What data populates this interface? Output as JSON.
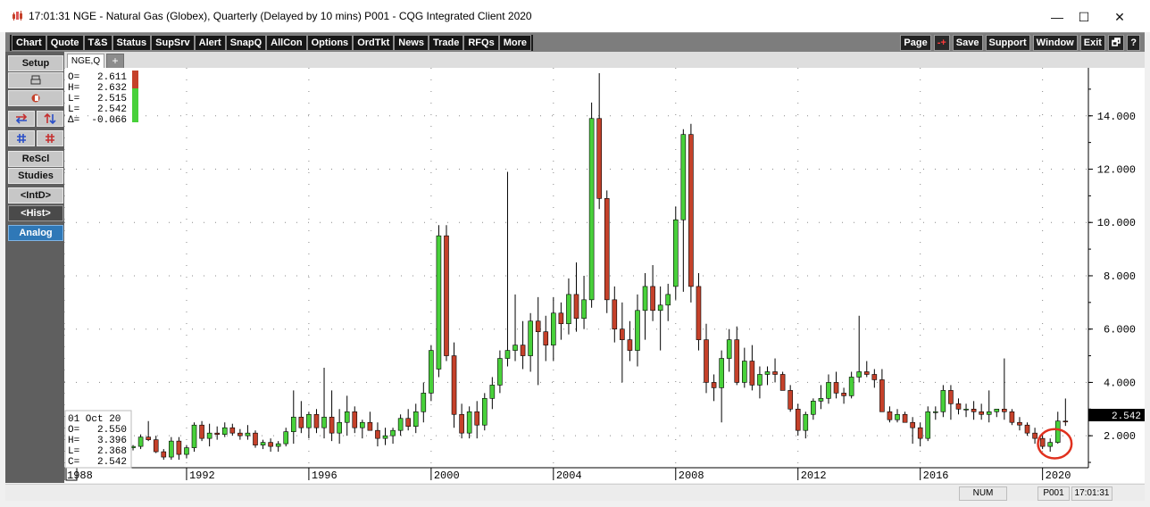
{
  "window": {
    "title": "17:01:31   NGE - Natural Gas (Globex), Quarterly (Delayed by 10 mins)   P001 - CQG Integrated Client 2020",
    "minimize": "—",
    "maximize": "☐",
    "close": "✕"
  },
  "toolbar": {
    "left": [
      "Chart",
      "Quote",
      "T&S",
      "Status",
      "SupSrv",
      "Alert",
      "SnapQ",
      "AllCon",
      "Options",
      "OrdTkt",
      "News",
      "Trade",
      "RFQs",
      "More"
    ],
    "right": [
      "Page",
      "-+",
      "Save",
      "Support",
      "Window",
      "Exit",
      "🗗",
      "?"
    ]
  },
  "sidebar": {
    "setup": "Setup",
    "rescl": "ReScl",
    "studies": "Studies",
    "intd": "<IntD>",
    "hist": "<Hist>",
    "analog": "Analog"
  },
  "tabs": {
    "active": "NGE,Q",
    "add": "+"
  },
  "status": {
    "num": "NUM",
    "page": "P001",
    "time": "17:01:31"
  },
  "chart_data": {
    "type": "candlestick",
    "symbol": "NGE,Q",
    "ylim": [
      0.8,
      15.8
    ],
    "yticks": [
      2,
      4,
      6,
      8,
      10,
      12,
      14
    ],
    "ytick_labels": [
      "2.000",
      "4.000",
      "6.000",
      "8.000",
      "10.000",
      "12.000",
      "14.000"
    ],
    "xlim": [
      1988,
      2021.5
    ],
    "xtick_labels": [
      "1988",
      "1992",
      "1996",
      "2000",
      "2004",
      "2008",
      "2012",
      "2016",
      "2020"
    ],
    "last_price": "2.542",
    "top_info": {
      "O": "2.611",
      "H": "2.632",
      "L": "2.515",
      "C": "2.542",
      "D": "-0.066"
    },
    "bottom_info": {
      "date": "01 Oct 20",
      "O": "2.550",
      "H": "3.396",
      "L": "2.368",
      "C": "2.542"
    },
    "candles": [
      {
        "t": 1990.25,
        "o": 1.55,
        "h": 1.65,
        "l": 1.45,
        "c": 1.6
      },
      {
        "t": 1990.5,
        "o": 1.6,
        "h": 2.05,
        "l": 1.5,
        "c": 1.95
      },
      {
        "t": 1990.75,
        "o": 1.95,
        "h": 2.55,
        "l": 1.8,
        "c": 1.85
      },
      {
        "t": 1991.0,
        "o": 1.85,
        "h": 2.0,
        "l": 1.35,
        "c": 1.4
      },
      {
        "t": 1991.25,
        "o": 1.4,
        "h": 1.5,
        "l": 1.1,
        "c": 1.2
      },
      {
        "t": 1991.5,
        "o": 1.2,
        "h": 1.95,
        "l": 1.1,
        "c": 1.8
      },
      {
        "t": 1991.75,
        "o": 1.8,
        "h": 1.95,
        "l": 1.1,
        "c": 1.3
      },
      {
        "t": 1992.0,
        "o": 1.3,
        "h": 1.65,
        "l": 1.15,
        "c": 1.55
      },
      {
        "t": 1992.25,
        "o": 1.55,
        "h": 2.5,
        "l": 1.4,
        "c": 2.4
      },
      {
        "t": 1992.5,
        "o": 2.4,
        "h": 2.55,
        "l": 1.8,
        "c": 1.9
      },
      {
        "t": 1992.75,
        "o": 1.9,
        "h": 2.45,
        "l": 1.6,
        "c": 2.1
      },
      {
        "t": 1993.0,
        "o": 2.1,
        "h": 2.35,
        "l": 1.85,
        "c": 2.05
      },
      {
        "t": 1993.25,
        "o": 2.05,
        "h": 2.5,
        "l": 1.95,
        "c": 2.3
      },
      {
        "t": 1993.5,
        "o": 2.3,
        "h": 2.45,
        "l": 2.0,
        "c": 2.1
      },
      {
        "t": 1993.75,
        "o": 2.1,
        "h": 2.25,
        "l": 1.85,
        "c": 2.0
      },
      {
        "t": 1994.0,
        "o": 2.0,
        "h": 2.4,
        "l": 1.85,
        "c": 2.1
      },
      {
        "t": 1994.25,
        "o": 2.1,
        "h": 2.2,
        "l": 1.55,
        "c": 1.65
      },
      {
        "t": 1994.5,
        "o": 1.65,
        "h": 1.85,
        "l": 1.5,
        "c": 1.75
      },
      {
        "t": 1994.75,
        "o": 1.75,
        "h": 1.9,
        "l": 1.4,
        "c": 1.6
      },
      {
        "t": 1995.0,
        "o": 1.6,
        "h": 1.8,
        "l": 1.4,
        "c": 1.7
      },
      {
        "t": 1995.25,
        "o": 1.7,
        "h": 2.3,
        "l": 1.6,
        "c": 2.15
      },
      {
        "t": 1995.5,
        "o": 2.15,
        "h": 3.7,
        "l": 1.7,
        "c": 2.7
      },
      {
        "t": 1995.75,
        "o": 2.7,
        "h": 3.3,
        "l": 2.1,
        "c": 2.3
      },
      {
        "t": 1996.0,
        "o": 2.3,
        "h": 2.9,
        "l": 1.9,
        "c": 2.8
      },
      {
        "t": 1996.25,
        "o": 2.8,
        "h": 3.0,
        "l": 2.1,
        "c": 2.3
      },
      {
        "t": 1996.5,
        "o": 2.3,
        "h": 4.55,
        "l": 1.9,
        "c": 2.7
      },
      {
        "t": 1996.75,
        "o": 2.7,
        "h": 3.7,
        "l": 1.8,
        "c": 2.1
      },
      {
        "t": 1997.0,
        "o": 2.1,
        "h": 3.0,
        "l": 1.7,
        "c": 2.5
      },
      {
        "t": 1997.25,
        "o": 2.5,
        "h": 3.5,
        "l": 2.0,
        "c": 2.9
      },
      {
        "t": 1997.5,
        "o": 2.9,
        "h": 3.1,
        "l": 2.1,
        "c": 2.3
      },
      {
        "t": 1997.75,
        "o": 2.3,
        "h": 2.6,
        "l": 1.9,
        "c": 2.5
      },
      {
        "t": 1998.0,
        "o": 2.5,
        "h": 2.9,
        "l": 2.2,
        "c": 2.2
      },
      {
        "t": 1998.25,
        "o": 2.2,
        "h": 2.5,
        "l": 1.6,
        "c": 1.9
      },
      {
        "t": 1998.5,
        "o": 1.9,
        "h": 2.3,
        "l": 1.65,
        "c": 2.0
      },
      {
        "t": 1998.75,
        "o": 2.0,
        "h": 2.3,
        "l": 1.7,
        "c": 2.2
      },
      {
        "t": 1999.0,
        "o": 2.2,
        "h": 2.8,
        "l": 2.0,
        "c": 2.65
      },
      {
        "t": 1999.25,
        "o": 2.65,
        "h": 3.0,
        "l": 2.2,
        "c": 2.35
      },
      {
        "t": 1999.5,
        "o": 2.35,
        "h": 3.2,
        "l": 2.1,
        "c": 2.9
      },
      {
        "t": 1999.75,
        "o": 2.9,
        "h": 4.0,
        "l": 2.5,
        "c": 3.6
      },
      {
        "t": 2000.0,
        "o": 3.6,
        "h": 5.4,
        "l": 3.3,
        "c": 5.2
      },
      {
        "t": 2000.25,
        "o": 4.5,
        "h": 9.9,
        "l": 4.2,
        "c": 9.5
      },
      {
        "t": 2000.5,
        "o": 9.5,
        "h": 9.9,
        "l": 4.8,
        "c": 5.0
      },
      {
        "t": 2000.75,
        "o": 5.0,
        "h": 5.5,
        "l": 2.3,
        "c": 2.8
      },
      {
        "t": 2001.0,
        "o": 2.8,
        "h": 3.2,
        "l": 1.9,
        "c": 2.1
      },
      {
        "t": 2001.25,
        "o": 2.1,
        "h": 3.1,
        "l": 1.9,
        "c": 2.9
      },
      {
        "t": 2001.5,
        "o": 2.9,
        "h": 3.3,
        "l": 1.9,
        "c": 2.4
      },
      {
        "t": 2001.75,
        "o": 2.4,
        "h": 3.6,
        "l": 2.2,
        "c": 3.4
      },
      {
        "t": 2002.0,
        "o": 3.4,
        "h": 4.2,
        "l": 3.0,
        "c": 3.9
      },
      {
        "t": 2002.25,
        "o": 3.9,
        "h": 5.2,
        "l": 3.6,
        "c": 4.9
      },
      {
        "t": 2002.5,
        "o": 4.9,
        "h": 11.9,
        "l": 4.6,
        "c": 5.2
      },
      {
        "t": 2002.75,
        "o": 5.2,
        "h": 7.3,
        "l": 4.8,
        "c": 5.4
      },
      {
        "t": 2003.0,
        "o": 5.4,
        "h": 6.3,
        "l": 4.5,
        "c": 5.0
      },
      {
        "t": 2003.25,
        "o": 5.0,
        "h": 6.6,
        "l": 4.4,
        "c": 6.3
      },
      {
        "t": 2003.5,
        "o": 6.3,
        "h": 7.2,
        "l": 3.9,
        "c": 5.9
      },
      {
        "t": 2003.75,
        "o": 5.9,
        "h": 6.5,
        "l": 4.8,
        "c": 5.4
      },
      {
        "t": 2004.0,
        "o": 5.4,
        "h": 7.2,
        "l": 4.8,
        "c": 6.6
      },
      {
        "t": 2004.25,
        "o": 6.6,
        "h": 7.0,
        "l": 5.6,
        "c": 6.2
      },
      {
        "t": 2004.5,
        "o": 6.2,
        "h": 7.9,
        "l": 5.8,
        "c": 7.3
      },
      {
        "t": 2004.75,
        "o": 7.3,
        "h": 8.5,
        "l": 5.9,
        "c": 6.4
      },
      {
        "t": 2005.0,
        "o": 6.4,
        "h": 8.0,
        "l": 6.0,
        "c": 7.1
      },
      {
        "t": 2005.25,
        "o": 7.1,
        "h": 14.5,
        "l": 6.8,
        "c": 13.9
      },
      {
        "t": 2005.5,
        "o": 13.9,
        "h": 15.6,
        "l": 10.5,
        "c": 10.9
      },
      {
        "t": 2005.75,
        "o": 10.9,
        "h": 11.2,
        "l": 6.6,
        "c": 7.1
      },
      {
        "t": 2006.0,
        "o": 7.1,
        "h": 7.6,
        "l": 5.5,
        "c": 6.0
      },
      {
        "t": 2006.25,
        "o": 6.0,
        "h": 7.0,
        "l": 4.0,
        "c": 5.6
      },
      {
        "t": 2006.5,
        "o": 5.6,
        "h": 6.3,
        "l": 4.8,
        "c": 5.2
      },
      {
        "t": 2006.75,
        "o": 5.2,
        "h": 7.3,
        "l": 4.6,
        "c": 6.7
      },
      {
        "t": 2007.0,
        "o": 6.7,
        "h": 8.1,
        "l": 5.6,
        "c": 7.6
      },
      {
        "t": 2007.25,
        "o": 7.6,
        "h": 8.4,
        "l": 6.3,
        "c": 6.7
      },
      {
        "t": 2007.5,
        "o": 6.7,
        "h": 7.6,
        "l": 5.2,
        "c": 6.9
      },
      {
        "t": 2007.75,
        "o": 6.9,
        "h": 7.7,
        "l": 6.3,
        "c": 7.3
      },
      {
        "t": 2008.0,
        "o": 7.6,
        "h": 10.6,
        "l": 7.1,
        "c": 10.1
      },
      {
        "t": 2008.25,
        "o": 10.1,
        "h": 13.5,
        "l": 7.4,
        "c": 13.3
      },
      {
        "t": 2008.5,
        "o": 13.3,
        "h": 13.7,
        "l": 7.0,
        "c": 7.6
      },
      {
        "t": 2008.75,
        "o": 7.6,
        "h": 8.1,
        "l": 5.2,
        "c": 5.6
      },
      {
        "t": 2009.0,
        "o": 5.6,
        "h": 6.2,
        "l": 3.6,
        "c": 4.0
      },
      {
        "t": 2009.25,
        "o": 4.0,
        "h": 4.3,
        "l": 3.3,
        "c": 3.8
      },
      {
        "t": 2009.5,
        "o": 3.8,
        "h": 5.2,
        "l": 2.5,
        "c": 4.9
      },
      {
        "t": 2009.75,
        "o": 4.9,
        "h": 6.0,
        "l": 4.4,
        "c": 5.6
      },
      {
        "t": 2010.0,
        "o": 5.6,
        "h": 6.1,
        "l": 3.9,
        "c": 4.0
      },
      {
        "t": 2010.25,
        "o": 4.0,
        "h": 5.3,
        "l": 3.8,
        "c": 4.8
      },
      {
        "t": 2010.5,
        "o": 4.8,
        "h": 5.4,
        "l": 3.7,
        "c": 3.9
      },
      {
        "t": 2010.75,
        "o": 3.9,
        "h": 4.6,
        "l": 3.4,
        "c": 4.3
      },
      {
        "t": 2011.0,
        "o": 4.3,
        "h": 4.6,
        "l": 3.9,
        "c": 4.4
      },
      {
        "t": 2011.25,
        "o": 4.4,
        "h": 4.9,
        "l": 4.0,
        "c": 4.3
      },
      {
        "t": 2011.5,
        "o": 4.3,
        "h": 4.4,
        "l": 3.7,
        "c": 3.7
      },
      {
        "t": 2011.75,
        "o": 3.7,
        "h": 3.9,
        "l": 2.9,
        "c": 3.0
      },
      {
        "t": 2012.0,
        "o": 3.0,
        "h": 3.2,
        "l": 2.0,
        "c": 2.2
      },
      {
        "t": 2012.25,
        "o": 2.2,
        "h": 2.9,
        "l": 1.9,
        "c": 2.8
      },
      {
        "t": 2012.5,
        "o": 2.8,
        "h": 3.4,
        "l": 2.6,
        "c": 3.3
      },
      {
        "t": 2012.75,
        "o": 3.3,
        "h": 3.9,
        "l": 3.0,
        "c": 3.4
      },
      {
        "t": 2013.0,
        "o": 3.4,
        "h": 4.3,
        "l": 3.2,
        "c": 4.0
      },
      {
        "t": 2013.25,
        "o": 4.0,
        "h": 4.4,
        "l": 3.4,
        "c": 3.6
      },
      {
        "t": 2013.5,
        "o": 3.6,
        "h": 3.8,
        "l": 3.2,
        "c": 3.5
      },
      {
        "t": 2013.75,
        "o": 3.5,
        "h": 4.4,
        "l": 3.4,
        "c": 4.2
      },
      {
        "t": 2014.0,
        "o": 4.2,
        "h": 6.5,
        "l": 4.0,
        "c": 4.4
      },
      {
        "t": 2014.25,
        "o": 4.4,
        "h": 4.8,
        "l": 4.2,
        "c": 4.3
      },
      {
        "t": 2014.5,
        "o": 4.3,
        "h": 4.5,
        "l": 3.8,
        "c": 4.1
      },
      {
        "t": 2014.75,
        "o": 4.1,
        "h": 4.5,
        "l": 2.9,
        "c": 2.9
      },
      {
        "t": 2015.0,
        "o": 2.9,
        "h": 3.1,
        "l": 2.5,
        "c": 2.6
      },
      {
        "t": 2015.25,
        "o": 2.6,
        "h": 3.0,
        "l": 2.5,
        "c": 2.8
      },
      {
        "t": 2015.5,
        "o": 2.8,
        "h": 2.9,
        "l": 2.5,
        "c": 2.5
      },
      {
        "t": 2015.75,
        "o": 2.5,
        "h": 2.7,
        "l": 1.7,
        "c": 2.3
      },
      {
        "t": 2016.0,
        "o": 2.3,
        "h": 2.5,
        "l": 1.6,
        "c": 1.9
      },
      {
        "t": 2016.25,
        "o": 1.9,
        "h": 3.1,
        "l": 1.8,
        "c": 2.9
      },
      {
        "t": 2016.5,
        "o": 2.9,
        "h": 3.1,
        "l": 2.6,
        "c": 2.9
      },
      {
        "t": 2016.75,
        "o": 2.9,
        "h": 3.9,
        "l": 2.7,
        "c": 3.7
      },
      {
        "t": 2017.0,
        "o": 3.7,
        "h": 3.9,
        "l": 2.6,
        "c": 3.2
      },
      {
        "t": 2017.25,
        "o": 3.2,
        "h": 3.4,
        "l": 2.8,
        "c": 3.0
      },
      {
        "t": 2017.5,
        "o": 3.0,
        "h": 3.2,
        "l": 2.7,
        "c": 3.0
      },
      {
        "t": 2017.75,
        "o": 3.0,
        "h": 3.3,
        "l": 2.6,
        "c": 2.9
      },
      {
        "t": 2018.0,
        "o": 2.9,
        "h": 3.2,
        "l": 2.6,
        "c": 2.8
      },
      {
        "t": 2018.25,
        "o": 2.8,
        "h": 3.7,
        "l": 2.5,
        "c": 2.9
      },
      {
        "t": 2018.5,
        "o": 2.9,
        "h": 3.0,
        "l": 2.7,
        "c": 3.0
      },
      {
        "t": 2018.75,
        "o": 3.0,
        "h": 4.9,
        "l": 2.6,
        "c": 2.9
      },
      {
        "t": 2019.0,
        "o": 2.9,
        "h": 3.0,
        "l": 2.4,
        "c": 2.5
      },
      {
        "t": 2019.25,
        "o": 2.5,
        "h": 2.7,
        "l": 2.2,
        "c": 2.4
      },
      {
        "t": 2019.5,
        "o": 2.4,
        "h": 2.5,
        "l": 2.0,
        "c": 2.1
      },
      {
        "t": 2019.75,
        "o": 2.1,
        "h": 2.3,
        "l": 1.7,
        "c": 1.9
      },
      {
        "t": 2020.0,
        "o": 1.9,
        "h": 2.1,
        "l": 1.5,
        "c": 1.6
      },
      {
        "t": 2020.25,
        "o": 1.6,
        "h": 1.9,
        "l": 1.4,
        "c": 1.75
      },
      {
        "t": 2020.5,
        "o": 1.75,
        "h": 2.9,
        "l": 1.7,
        "c": 2.55
      },
      {
        "t": 2020.75,
        "o": 2.55,
        "h": 3.396,
        "l": 2.368,
        "c": 2.542
      }
    ],
    "colors": {
      "up": "#48d13a",
      "down": "#c5412a",
      "grid": "#888888",
      "highlight_circle": "#e0301e"
    },
    "highlight": {
      "t": 2020.4,
      "y": 1.7,
      "rx_years": 0.55,
      "ry_price": 0.55
    }
  }
}
